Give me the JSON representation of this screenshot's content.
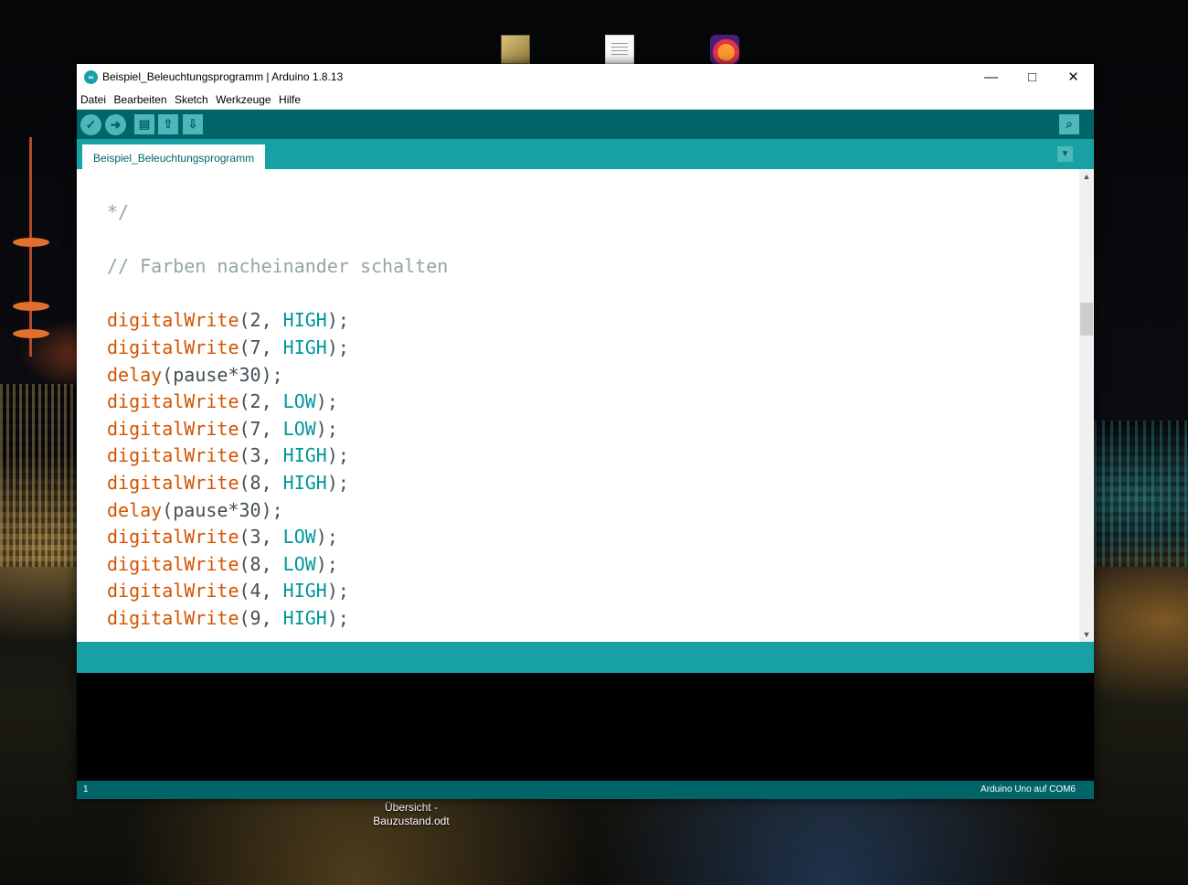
{
  "desktop": {
    "icon_label": "Übersicht -\nBauzustand.odt",
    "icons": [
      "image-file-icon",
      "document-icon",
      "firefox-icon"
    ]
  },
  "window": {
    "title": "Beispiel_Beleuchtungsprogramm | Arduino 1.8.13",
    "controls": {
      "minimize": "—",
      "maximize": "□",
      "close": "✕"
    }
  },
  "menu": [
    "Datei",
    "Bearbeiten",
    "Sketch",
    "Werkzeuge",
    "Hilfe"
  ],
  "toolbar": {
    "buttons": [
      "verify",
      "upload",
      "new",
      "open",
      "save"
    ],
    "serial_monitor": "serial-monitor"
  },
  "tabs": [
    {
      "label": "Beispiel_Beleuchtungsprogramm"
    }
  ],
  "editor": {
    "lines": [
      [
        {
          "t": "*/",
          "c": "cmt"
        }
      ],
      [],
      [
        {
          "t": "// Farben nacheinander schalten",
          "c": "cmt"
        }
      ],
      [],
      [
        {
          "t": "digitalWrite",
          "c": "fn"
        },
        {
          "t": "(2, "
        },
        {
          "t": "HIGH",
          "c": "kw"
        },
        {
          "t": ");"
        }
      ],
      [
        {
          "t": "digitalWrite",
          "c": "fn"
        },
        {
          "t": "(7, "
        },
        {
          "t": "HIGH",
          "c": "kw"
        },
        {
          "t": ");"
        }
      ],
      [
        {
          "t": "delay",
          "c": "fn"
        },
        {
          "t": "(pause*30);"
        }
      ],
      [
        {
          "t": "digitalWrite",
          "c": "fn"
        },
        {
          "t": "(2, "
        },
        {
          "t": "LOW",
          "c": "kw"
        },
        {
          "t": ");"
        }
      ],
      [
        {
          "t": "digitalWrite",
          "c": "fn"
        },
        {
          "t": "(7, "
        },
        {
          "t": "LOW",
          "c": "kw"
        },
        {
          "t": ");"
        }
      ],
      [
        {
          "t": "digitalWrite",
          "c": "fn"
        },
        {
          "t": "(3, "
        },
        {
          "t": "HIGH",
          "c": "kw"
        },
        {
          "t": ");"
        }
      ],
      [
        {
          "t": "digitalWrite",
          "c": "fn"
        },
        {
          "t": "(8, "
        },
        {
          "t": "HIGH",
          "c": "kw"
        },
        {
          "t": ");"
        }
      ],
      [
        {
          "t": "delay",
          "c": "fn"
        },
        {
          "t": "(pause*30);"
        }
      ],
      [
        {
          "t": "digitalWrite",
          "c": "fn"
        },
        {
          "t": "(3, "
        },
        {
          "t": "LOW",
          "c": "kw"
        },
        {
          "t": ");"
        }
      ],
      [
        {
          "t": "digitalWrite",
          "c": "fn"
        },
        {
          "t": "(8, "
        },
        {
          "t": "LOW",
          "c": "kw"
        },
        {
          "t": ");"
        }
      ],
      [
        {
          "t": "digitalWrite",
          "c": "fn"
        },
        {
          "t": "(4, "
        },
        {
          "t": "HIGH",
          "c": "kw"
        },
        {
          "t": ");"
        }
      ],
      [
        {
          "t": "digitalWrite",
          "c": "fn"
        },
        {
          "t": "(9, "
        },
        {
          "t": "HIGH",
          "c": "kw"
        },
        {
          "t": ");"
        }
      ]
    ]
  },
  "footer": {
    "line_number": "1",
    "board": "Arduino Uno auf COM6"
  },
  "colors": {
    "toolbar": "#006468",
    "tabbar": "#17a1a5",
    "function": "#d35400",
    "constant": "#00979c",
    "comment": "#95a5a6"
  }
}
